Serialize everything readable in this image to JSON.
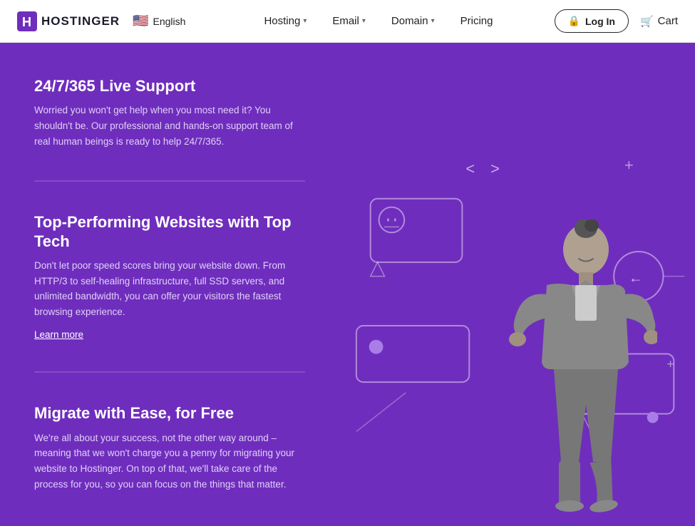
{
  "navbar": {
    "logo_text": "HOSTINGER",
    "lang_flag": "🇺🇸",
    "lang_label": "English",
    "nav_items": [
      {
        "label": "Hosting",
        "has_dropdown": true
      },
      {
        "label": "Email",
        "has_dropdown": true
      },
      {
        "label": "Domain",
        "has_dropdown": true
      },
      {
        "label": "Pricing",
        "has_dropdown": false
      }
    ],
    "login_label": "Log In",
    "cart_label": "Cart"
  },
  "hero": {
    "features": [
      {
        "title": "24/7/365 Live Support",
        "desc": "Worried you won't get help when you most need it? You shouldn't be. Our professional and hands-on support team of real human beings is ready to help 24/7/365.",
        "learn_more": null
      },
      {
        "title": "Top-Performing Websites with Top Tech",
        "desc": "Don't let poor speed scores bring your website down. From HTTP/3 to self-healing infrastructure, full SSD servers, and unlimited bandwidth, you can offer your visitors the fastest browsing experience.",
        "learn_more": "Learn more"
      },
      {
        "title": "Migrate with Ease, for Free",
        "desc": "We're all about your success, not the other way around – meaning that we won't charge you a penny for migrating your website to Hostinger. On top of that, we'll take care of the process for you, so you can focus on the things that matter.",
        "learn_more": null
      }
    ],
    "bg_color": "#6f2dbd"
  },
  "icons": {
    "logo": "H",
    "lock": "🔒",
    "cart": "🛒",
    "chevron_down": "▾"
  }
}
